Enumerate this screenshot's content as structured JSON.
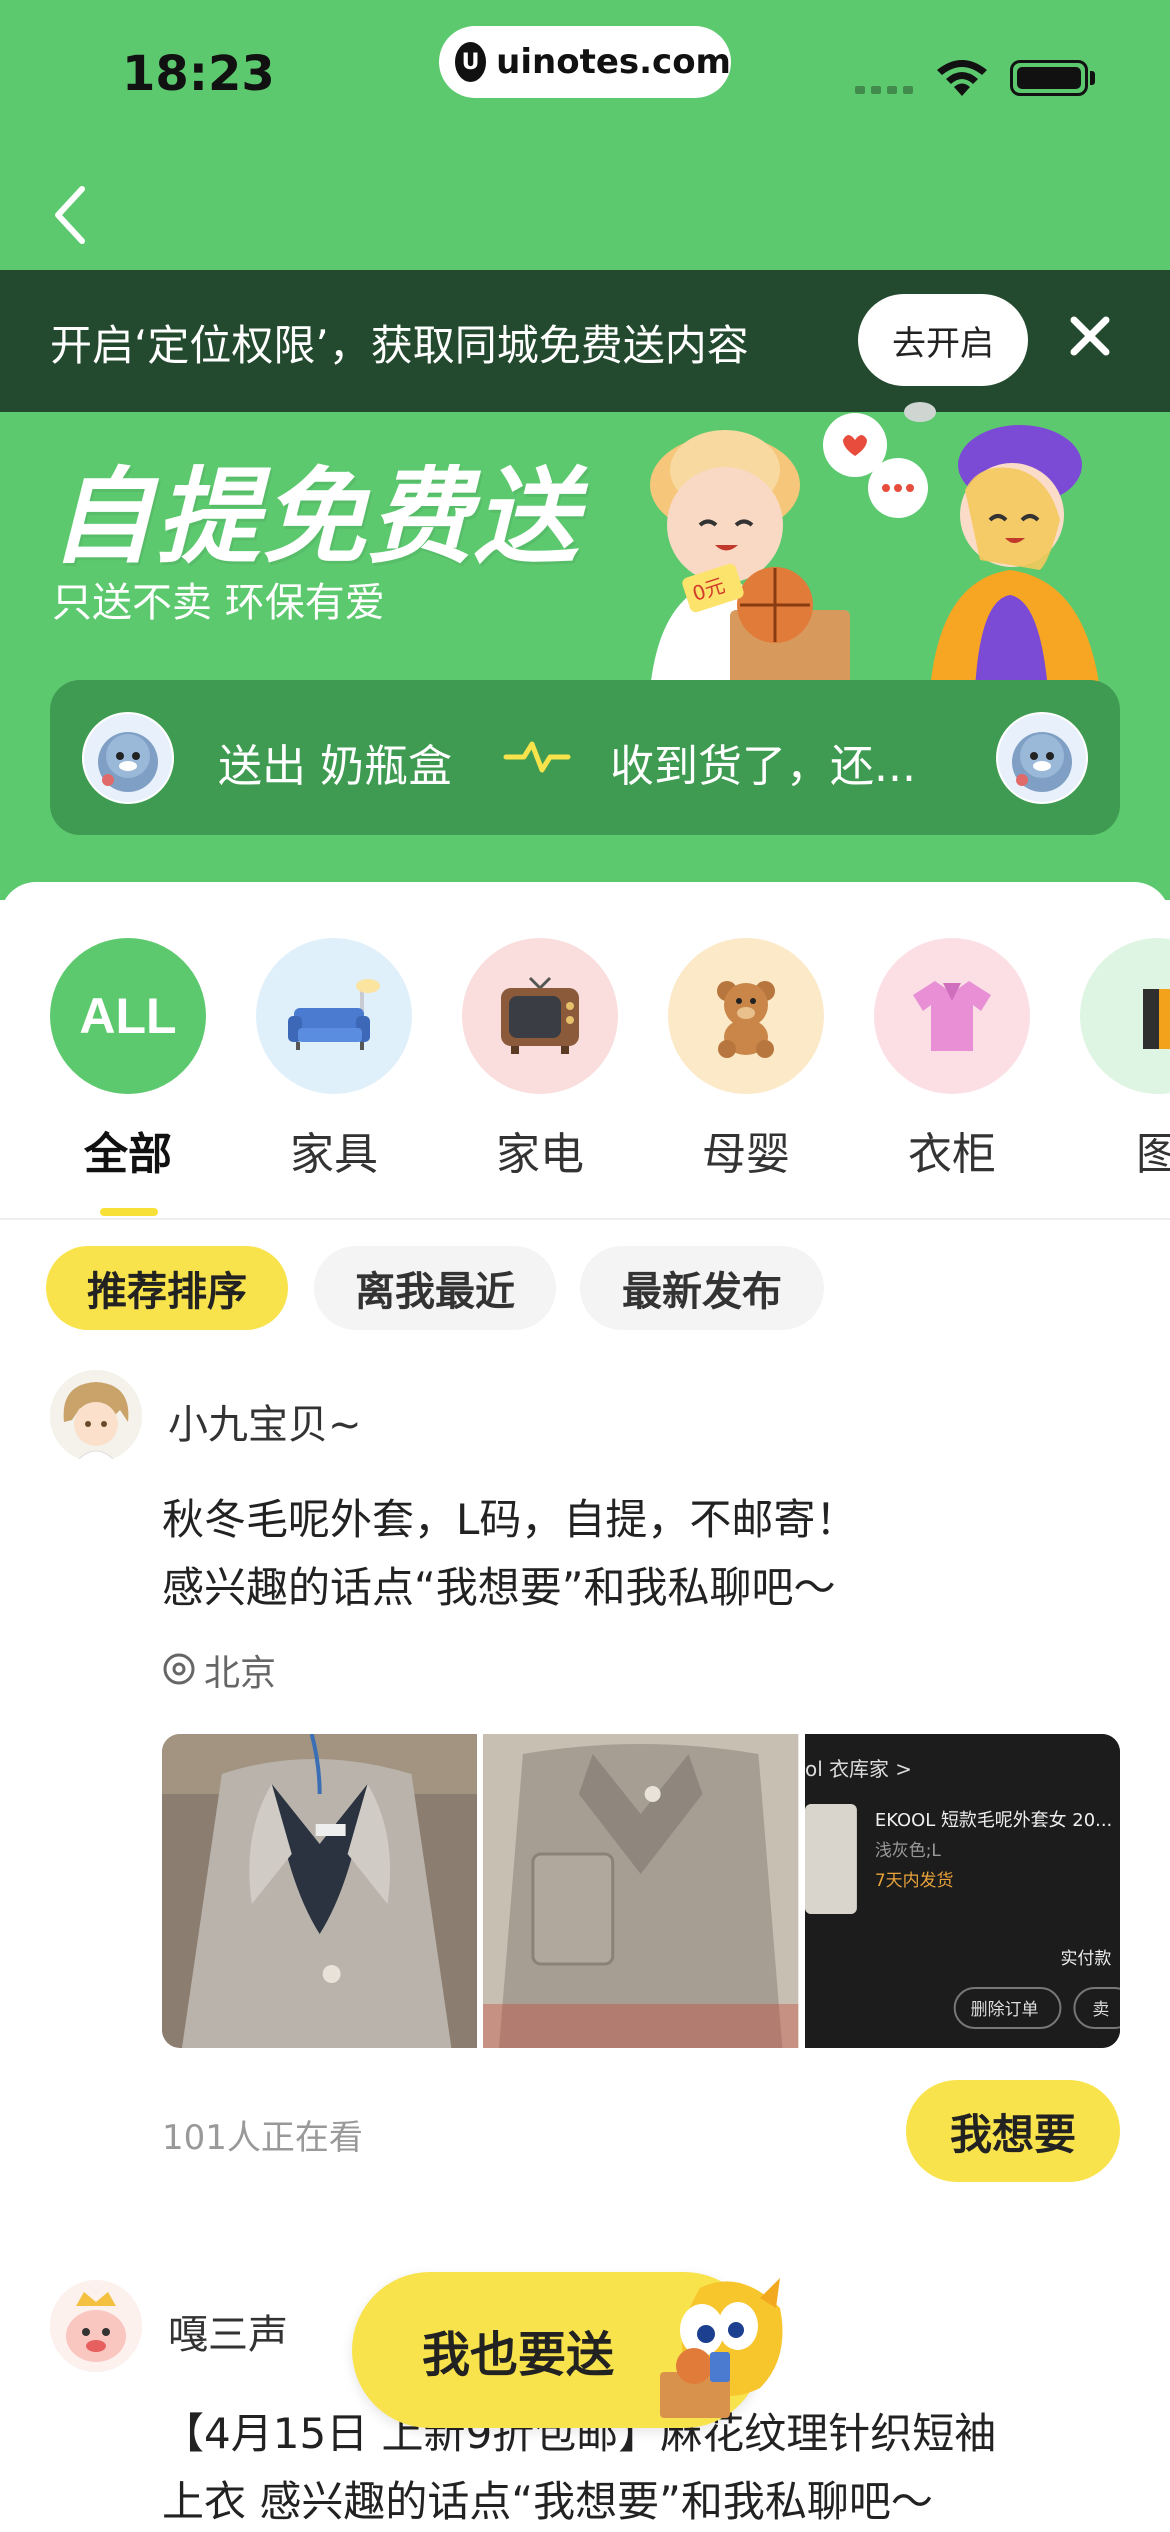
{
  "status_bar": {
    "time": "18:23",
    "url": "uinotes.com",
    "url_logo": "U"
  },
  "location_banner": {
    "text": "开启‘定位权限’，获取同城免费送内容",
    "button": "去开启"
  },
  "hero": {
    "title": "自提免费送",
    "subtitle": "只送不卖 环保有爱",
    "sticker_price": "0元"
  },
  "ticker": {
    "left_text": "送出 奶瓶盒",
    "right_text": "收到货了，还..."
  },
  "categories": [
    {
      "label": "全部",
      "icon": "ALL",
      "icon_name": "all-icon",
      "bg": "#5dc96f",
      "active": true
    },
    {
      "label": "家具",
      "icon_name": "sofa-icon",
      "bg": "#dff0fb"
    },
    {
      "label": "家电",
      "icon_name": "tv-icon",
      "bg": "#fadedd"
    },
    {
      "label": "母婴",
      "icon_name": "teddy-bear-icon",
      "bg": "#fbe9c8"
    },
    {
      "label": "衣柜",
      "icon_name": "shirt-icon",
      "bg": "#fbdfe4"
    },
    {
      "label": "图",
      "icon_name": "book-icon",
      "bg": "#def5e3"
    }
  ],
  "sort_options": [
    "推荐排序",
    "离我最近",
    "最新发布"
  ],
  "posts": [
    {
      "user": "小九宝贝~",
      "text_line1": "秋冬毛呢外套，L码，自提，不邮寄！",
      "text_line2": "感兴趣的话点“我想要”和我私聊吧～",
      "location": "北京",
      "viewers": "101人正在看",
      "want_button": "我想要",
      "screenshot_card": {
        "shop": "ol 衣库家 >",
        "product": "EKOOL 短款毛呢外套女 20...",
        "spec": "浅灰色;L",
        "shipping": "7天内发货",
        "paid": "实付款",
        "btn_delete": "删除订单",
        "btn_sell": "卖"
      }
    },
    {
      "user": "嘎三声",
      "text_line1": "【4月15日 上新9折包邮】麻花纹理针织短袖",
      "text_line2": "上衣 感兴趣的话点“我想要”和我私聊吧～"
    }
  ],
  "float_button": "我也要送",
  "colors": {
    "green": "#5dc96f",
    "dark_green": "#234a2e",
    "ticker_green": "#3f9b51",
    "yellow": "#f8e34c"
  }
}
